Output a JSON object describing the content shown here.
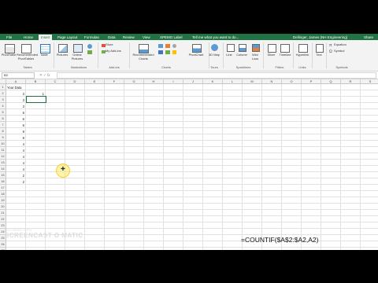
{
  "tabs": [
    "File",
    "Home",
    "Insert",
    "Page Layout",
    "Formulas",
    "Data",
    "Review",
    "View",
    "XPEMO Label"
  ],
  "active_tab": "Insert",
  "tell_me": "Tell me what you want to do...",
  "user": "Dellinger, James (NH Engineering)",
  "share": "Share",
  "ribbon": {
    "pivot": "PivotTable",
    "recommended_pivots": "Recommended PivotTables",
    "table": "Table",
    "pictures": "Pictures",
    "online_pictures": "Online Pictures",
    "store": "Store",
    "my_addins": "My Add-ins",
    "recommended_charts": "Recommended Charts",
    "pivotchart": "PivotChart",
    "map3d": "3D Map",
    "line": "Line",
    "column": "Column",
    "winloss": "Win/ Loss",
    "slicer": "Slicer",
    "timeline": "Timeline",
    "hyperlink": "Hyperlink",
    "text": "Text",
    "equation": "Equation",
    "symbol": "Symbol",
    "groups": {
      "tables": "Tables",
      "illustrations": "Illustrations",
      "addins": "Add-ins",
      "charts": "Charts",
      "tours": "Tours",
      "sparklines": "Sparklines",
      "filters": "Filters",
      "links": "Links",
      "symbols": "Symbols"
    }
  },
  "name_box": "B3",
  "fx": "fx",
  "columns": [
    "A",
    "B",
    "C",
    "D",
    "E",
    "F",
    "G",
    "H",
    "I",
    "J",
    "K",
    "L",
    "M",
    "N",
    "O",
    "P",
    "Q",
    "R",
    "S",
    "T"
  ],
  "rows": [
    "1",
    "2",
    "3",
    "4",
    "5",
    "6",
    "7",
    "8",
    "9",
    "10",
    "11",
    "12",
    "13",
    "14",
    "15",
    "16",
    "17",
    "18",
    "19",
    "20",
    "21",
    "22",
    "23",
    "24",
    "25",
    "26",
    "27"
  ],
  "header_cell": "Your Data",
  "data_values": [
    "3",
    "3",
    "3",
    "5",
    "6",
    "6",
    "9",
    "8",
    "4",
    "4",
    "4",
    "4",
    "4",
    "2",
    "2"
  ],
  "b2_value": "1",
  "formula_text": "=COUNTIF($A$2:$A2,A2)",
  "watermark_top": "RECORDED WITH",
  "watermark_main": "SCREENCAST O MATIC",
  "accent": "#217346"
}
